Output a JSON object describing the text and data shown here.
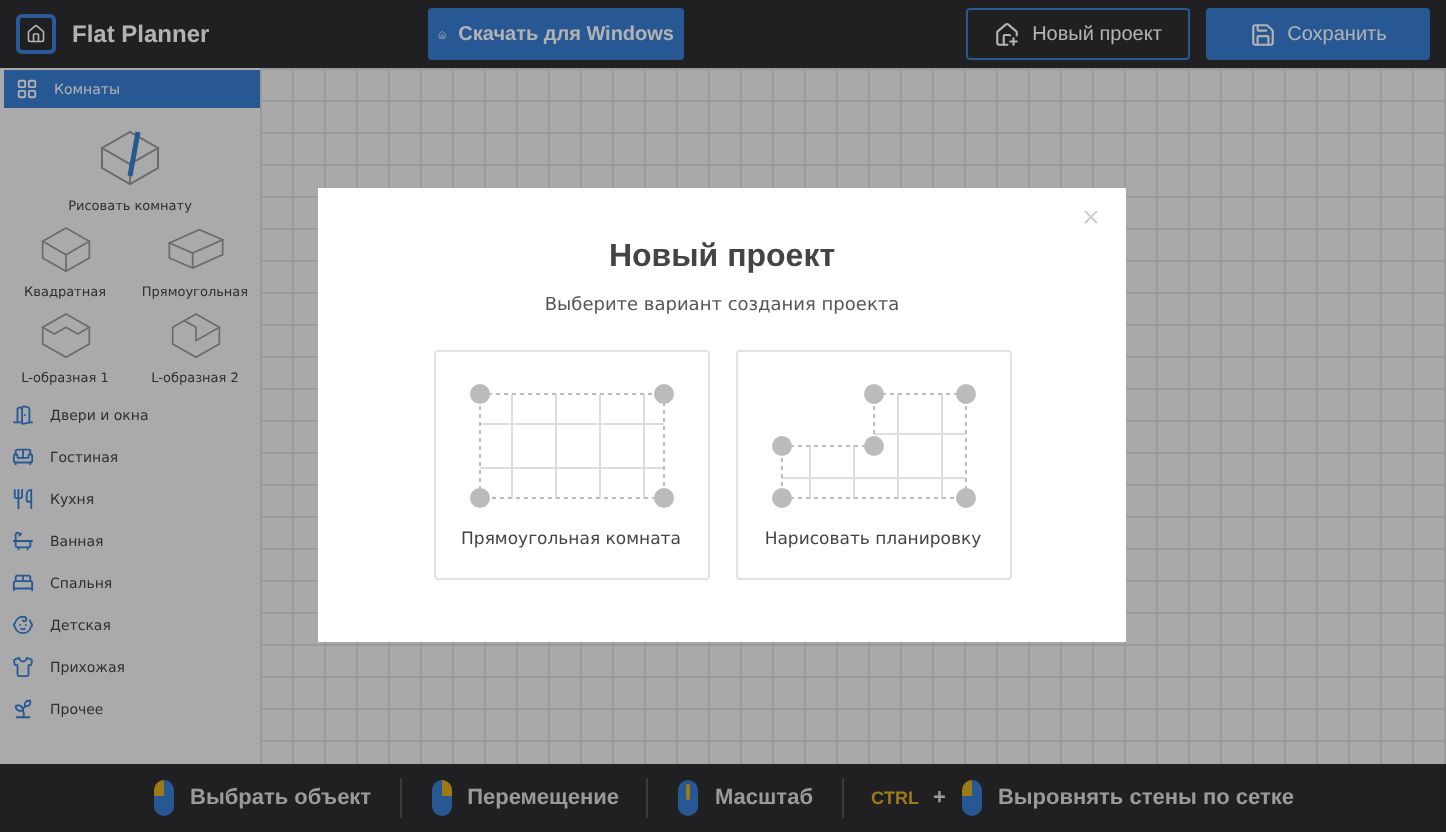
{
  "header": {
    "app_name": "Flat Planner",
    "buttons": [
      {
        "label": "Скачать для Windows",
        "kind": "download"
      },
      {
        "label": "Новый проект",
        "kind": "new"
      },
      {
        "label": "Сохранить",
        "kind": "save"
      }
    ]
  },
  "sidebar": {
    "categories": [
      {
        "label": "Комнаты",
        "kind": "grid",
        "selected": true,
        "rooms": [
          {
            "label": "Рисовать комнату",
            "kind": "draw"
          },
          {
            "label": "Квадратная",
            "kind": "square"
          },
          {
            "label": "Прямоугольная",
            "kind": "rect"
          },
          {
            "label": "L-образная 1",
            "kind": "l1"
          },
          {
            "label": "L-образная 2",
            "kind": "l2"
          }
        ]
      },
      {
        "label": "Двери и окна",
        "kind": "door",
        "selected": false
      },
      {
        "label": "Гостиная",
        "kind": "sofa",
        "selected": false
      },
      {
        "label": "Кухня",
        "kind": "kitchen",
        "selected": false
      },
      {
        "label": "Ванная",
        "kind": "bath",
        "selected": false
      },
      {
        "label": "Спальня",
        "kind": "bed",
        "selected": false
      },
      {
        "label": "Детская",
        "kind": "kids",
        "selected": false
      },
      {
        "label": "Прихожая",
        "kind": "hanger",
        "selected": false
      },
      {
        "label": "Прочее",
        "kind": "plant",
        "selected": false
      }
    ]
  },
  "dialog": {
    "title": "Новый проект",
    "subtitle": "Выберите вариант создания проекта",
    "options": [
      {
        "label": "Прямоугольная комната",
        "kind": "rect"
      },
      {
        "label": "Нарисовать планировку",
        "kind": "free"
      }
    ]
  },
  "hint_bar": {
    "hints": [
      {
        "label": "Выбрать объект",
        "kind": "left"
      },
      {
        "label": "Перемещение",
        "kind": "right"
      },
      {
        "label": "Масштаб",
        "kind": "wheel"
      },
      {
        "label": "Выровнять стены по сетке",
        "kind": "left",
        "key": "CTRL",
        "plus": "+"
      }
    ]
  }
}
